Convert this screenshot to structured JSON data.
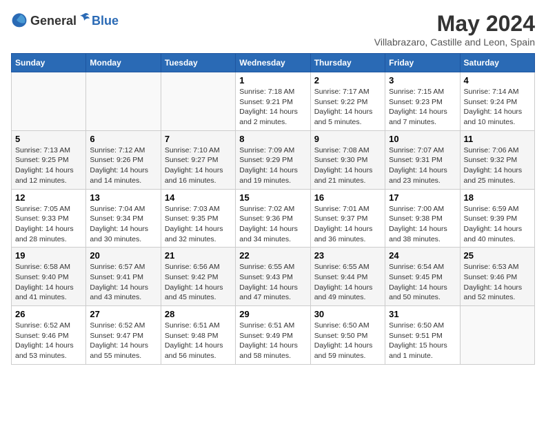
{
  "logo": {
    "general": "General",
    "blue": "Blue"
  },
  "title": "May 2024",
  "subtitle": "Villabrazaro, Castille and Leon, Spain",
  "days_header": [
    "Sunday",
    "Monday",
    "Tuesday",
    "Wednesday",
    "Thursday",
    "Friday",
    "Saturday"
  ],
  "weeks": [
    [
      {
        "num": "",
        "info": ""
      },
      {
        "num": "",
        "info": ""
      },
      {
        "num": "",
        "info": ""
      },
      {
        "num": "1",
        "info": "Sunrise: 7:18 AM\nSunset: 9:21 PM\nDaylight: 14 hours\nand 2 minutes."
      },
      {
        "num": "2",
        "info": "Sunrise: 7:17 AM\nSunset: 9:22 PM\nDaylight: 14 hours\nand 5 minutes."
      },
      {
        "num": "3",
        "info": "Sunrise: 7:15 AM\nSunset: 9:23 PM\nDaylight: 14 hours\nand 7 minutes."
      },
      {
        "num": "4",
        "info": "Sunrise: 7:14 AM\nSunset: 9:24 PM\nDaylight: 14 hours\nand 10 minutes."
      }
    ],
    [
      {
        "num": "5",
        "info": "Sunrise: 7:13 AM\nSunset: 9:25 PM\nDaylight: 14 hours\nand 12 minutes."
      },
      {
        "num": "6",
        "info": "Sunrise: 7:12 AM\nSunset: 9:26 PM\nDaylight: 14 hours\nand 14 minutes."
      },
      {
        "num": "7",
        "info": "Sunrise: 7:10 AM\nSunset: 9:27 PM\nDaylight: 14 hours\nand 16 minutes."
      },
      {
        "num": "8",
        "info": "Sunrise: 7:09 AM\nSunset: 9:29 PM\nDaylight: 14 hours\nand 19 minutes."
      },
      {
        "num": "9",
        "info": "Sunrise: 7:08 AM\nSunset: 9:30 PM\nDaylight: 14 hours\nand 21 minutes."
      },
      {
        "num": "10",
        "info": "Sunrise: 7:07 AM\nSunset: 9:31 PM\nDaylight: 14 hours\nand 23 minutes."
      },
      {
        "num": "11",
        "info": "Sunrise: 7:06 AM\nSunset: 9:32 PM\nDaylight: 14 hours\nand 25 minutes."
      }
    ],
    [
      {
        "num": "12",
        "info": "Sunrise: 7:05 AM\nSunset: 9:33 PM\nDaylight: 14 hours\nand 28 minutes."
      },
      {
        "num": "13",
        "info": "Sunrise: 7:04 AM\nSunset: 9:34 PM\nDaylight: 14 hours\nand 30 minutes."
      },
      {
        "num": "14",
        "info": "Sunrise: 7:03 AM\nSunset: 9:35 PM\nDaylight: 14 hours\nand 32 minutes."
      },
      {
        "num": "15",
        "info": "Sunrise: 7:02 AM\nSunset: 9:36 PM\nDaylight: 14 hours\nand 34 minutes."
      },
      {
        "num": "16",
        "info": "Sunrise: 7:01 AM\nSunset: 9:37 PM\nDaylight: 14 hours\nand 36 minutes."
      },
      {
        "num": "17",
        "info": "Sunrise: 7:00 AM\nSunset: 9:38 PM\nDaylight: 14 hours\nand 38 minutes."
      },
      {
        "num": "18",
        "info": "Sunrise: 6:59 AM\nSunset: 9:39 PM\nDaylight: 14 hours\nand 40 minutes."
      }
    ],
    [
      {
        "num": "19",
        "info": "Sunrise: 6:58 AM\nSunset: 9:40 PM\nDaylight: 14 hours\nand 41 minutes."
      },
      {
        "num": "20",
        "info": "Sunrise: 6:57 AM\nSunset: 9:41 PM\nDaylight: 14 hours\nand 43 minutes."
      },
      {
        "num": "21",
        "info": "Sunrise: 6:56 AM\nSunset: 9:42 PM\nDaylight: 14 hours\nand 45 minutes."
      },
      {
        "num": "22",
        "info": "Sunrise: 6:55 AM\nSunset: 9:43 PM\nDaylight: 14 hours\nand 47 minutes."
      },
      {
        "num": "23",
        "info": "Sunrise: 6:55 AM\nSunset: 9:44 PM\nDaylight: 14 hours\nand 49 minutes."
      },
      {
        "num": "24",
        "info": "Sunrise: 6:54 AM\nSunset: 9:45 PM\nDaylight: 14 hours\nand 50 minutes."
      },
      {
        "num": "25",
        "info": "Sunrise: 6:53 AM\nSunset: 9:46 PM\nDaylight: 14 hours\nand 52 minutes."
      }
    ],
    [
      {
        "num": "26",
        "info": "Sunrise: 6:52 AM\nSunset: 9:46 PM\nDaylight: 14 hours\nand 53 minutes."
      },
      {
        "num": "27",
        "info": "Sunrise: 6:52 AM\nSunset: 9:47 PM\nDaylight: 14 hours\nand 55 minutes."
      },
      {
        "num": "28",
        "info": "Sunrise: 6:51 AM\nSunset: 9:48 PM\nDaylight: 14 hours\nand 56 minutes."
      },
      {
        "num": "29",
        "info": "Sunrise: 6:51 AM\nSunset: 9:49 PM\nDaylight: 14 hours\nand 58 minutes."
      },
      {
        "num": "30",
        "info": "Sunrise: 6:50 AM\nSunset: 9:50 PM\nDaylight: 14 hours\nand 59 minutes."
      },
      {
        "num": "31",
        "info": "Sunrise: 6:50 AM\nSunset: 9:51 PM\nDaylight: 15 hours\nand 1 minute."
      },
      {
        "num": "",
        "info": ""
      }
    ]
  ]
}
